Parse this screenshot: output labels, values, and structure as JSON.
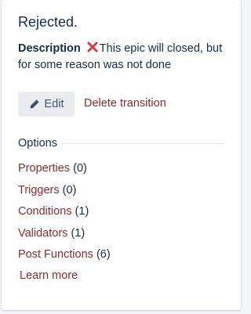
{
  "transition": {
    "title": "Rejected.",
    "description_label": "Description",
    "description_text": "This epic will closed, but for some reason was not done"
  },
  "actions": {
    "edit_label": "Edit",
    "delete_label": "Delete transition"
  },
  "options": {
    "header": "Options",
    "items": [
      {
        "label": "Properties",
        "count": "(0)"
      },
      {
        "label": "Triggers",
        "count": "(0)"
      },
      {
        "label": "Conditions",
        "count": "(1)"
      },
      {
        "label": "Validators",
        "count": "(1)"
      },
      {
        "label": "Post Functions",
        "count": "(6)"
      }
    ],
    "learn_more": "Learn more"
  },
  "icons": {
    "cross": "cross-mark-icon",
    "edit": "pencil-icon"
  },
  "colors": {
    "link": "#8b2b2b",
    "text": "#172b4d",
    "cross": "#e2373f",
    "button_bg": "#ebecf0"
  }
}
